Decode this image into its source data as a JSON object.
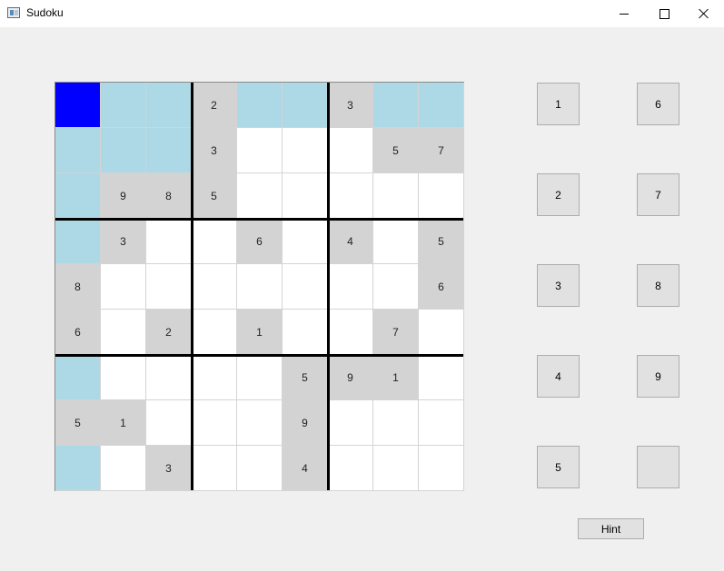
{
  "window": {
    "title": "Sudoku",
    "icon": "sudoku-app-icon"
  },
  "board": {
    "selected": [
      0,
      0
    ],
    "rows": [
      [
        "",
        "",
        "",
        "2",
        "",
        "",
        "3",
        "",
        ""
      ],
      [
        "",
        "",
        "",
        "3",
        "",
        "",
        "",
        "5",
        "7"
      ],
      [
        "",
        "9",
        "8",
        "5",
        "",
        "",
        "",
        "",
        ""
      ],
      [
        "",
        "3",
        "",
        "",
        "6",
        "",
        "4",
        "",
        "5"
      ],
      [
        "8",
        "",
        "",
        "",
        "",
        "",
        "",
        "",
        "6"
      ],
      [
        "6",
        "",
        "2",
        "",
        "1",
        "",
        "",
        "7",
        ""
      ],
      [
        "",
        "",
        "",
        "",
        "",
        "5",
        "9",
        "1",
        ""
      ],
      [
        "5",
        "1",
        "",
        "",
        "",
        "9",
        "",
        "",
        ""
      ],
      [
        "",
        "",
        "3",
        "",
        "",
        "4",
        "",
        "",
        ""
      ]
    ]
  },
  "number_pad": [
    "1",
    "6",
    "2",
    "7",
    "3",
    "8",
    "4",
    "9",
    "5",
    ""
  ],
  "hint_label": "Hint",
  "colors": {
    "selected": "#0000ff",
    "highlight": "#add8e6",
    "given": "#d3d3d3",
    "empty": "#ffffff"
  }
}
